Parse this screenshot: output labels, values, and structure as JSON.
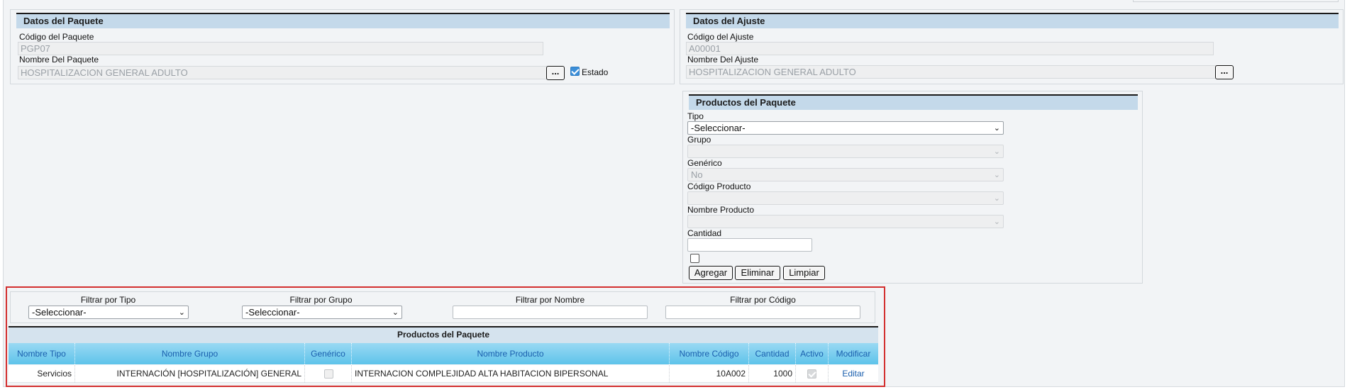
{
  "datos_paquete": {
    "header": "Datos del Paquete",
    "codigo_label": "Código del Paquete",
    "codigo_value": "PGP07",
    "nombre_label": "Nombre Del Paquete",
    "nombre_value": "HOSPITALIZACION GENERAL ADULTO",
    "lookup_button": "...",
    "estado_label": "Estado",
    "estado_checked": true
  },
  "datos_ajuste": {
    "header": "Datos del Ajuste",
    "codigo_label": "Código del Ajuste",
    "codigo_value": "A00001",
    "nombre_label": "Nombre Del Ajuste",
    "nombre_value": "HOSPITALIZACION GENERAL ADULTO",
    "lookup_button": "..."
  },
  "productos_form": {
    "header": "Productos del Paquete",
    "tipo_label": "Tipo",
    "tipo_value": "-Seleccionar-",
    "grupo_label": "Grupo",
    "grupo_value": "",
    "generico_label": "Genérico",
    "generico_value": "No",
    "codigo_producto_label": "Código Producto",
    "codigo_producto_value": "",
    "nombre_producto_label": "Nombre Producto",
    "nombre_producto_value": "",
    "cantidad_label": "Cantidad",
    "buttons": {
      "agregar": "Agregar",
      "eliminar": "Eliminar",
      "limpiar": "Limpiar"
    }
  },
  "filters": {
    "tipo_label": "Filtrar por Tipo",
    "tipo_value": "-Seleccionar-",
    "grupo_label": "Filtrar por Grupo",
    "grupo_value": "-Seleccionar-",
    "nombre_label": "Filtrar por Nombre",
    "codigo_label": "Filtrar por Código"
  },
  "grid": {
    "title": "Productos del Paquete",
    "columns": [
      "Nombre Tipo",
      "Nombre Grupo",
      "Genérico",
      "Nombre Producto",
      "Nombre Código",
      "Cantidad",
      "Activo",
      "Modificar"
    ],
    "rows": [
      {
        "tipo": "Servicios",
        "grupo": "INTERNACIÓN [HOSPITALIZACIÓN] GENERAL",
        "generico": false,
        "producto": "INTERNACION COMPLEJIDAD ALTA HABITACION BIPERSONAL",
        "codigo": "10A002",
        "cantidad": "1000",
        "activo": true,
        "modificar": "Editar"
      }
    ]
  },
  "colors": {
    "panel_header_bg": "#c4d9ea",
    "grid_header_bg": "#5ec3ea",
    "grid_header_text": "#1a5fae",
    "highlight_border": "#d32f2f",
    "checkbox_checked": "#3b8ed8"
  },
  "icons": {
    "dropdown": "chevron-down-icon",
    "check": "checkmark-icon"
  }
}
